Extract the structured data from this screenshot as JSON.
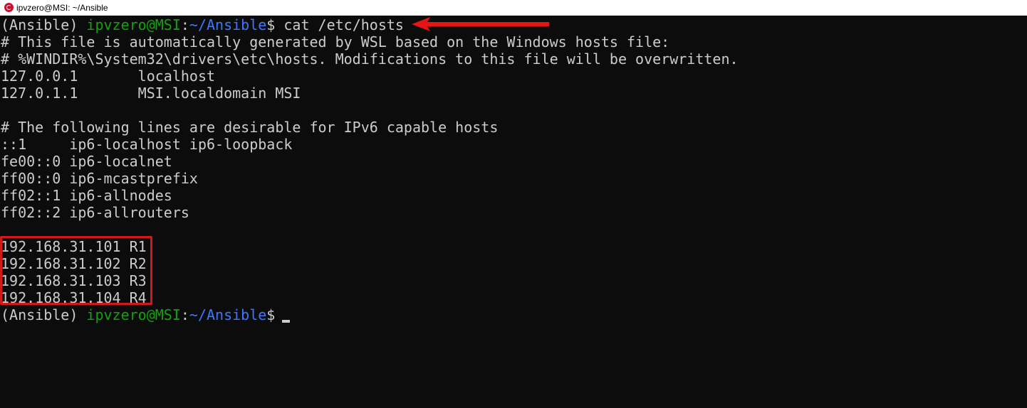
{
  "window": {
    "title": "ipvzero@MSI: ~/Ansible",
    "icon": "debian-swirl-icon",
    "accent_color": "#c8102e"
  },
  "prompt": {
    "env": "(Ansible)",
    "user_host": "ipvzero@MSI",
    "colon": ":",
    "path": "~/Ansible",
    "symbol": "$",
    "user_color": "#13a10e",
    "path_color": "#3b78ff"
  },
  "command": "cat /etc/hosts",
  "output": [
    "# This file is automatically generated by WSL based on the Windows hosts file:",
    "# %WINDIR%\\System32\\drivers\\etc\\hosts. Modifications to this file will be overwritten.",
    "127.0.0.1       localhost",
    "127.0.1.1       MSI.localdomain MSI",
    "",
    "# The following lines are desirable for IPv6 capable hosts",
    "::1     ip6-localhost ip6-loopback",
    "fe00::0 ip6-localnet",
    "ff00::0 ip6-mcastprefix",
    "ff02::1 ip6-allnodes",
    "ff02::2 ip6-allrouters",
    "",
    "192.168.31.101 R1",
    "192.168.31.102 R2",
    "192.168.31.103 R3",
    "192.168.31.104 R4"
  ],
  "annotations": {
    "arrow_color": "#e81414",
    "box_color": "#d11919",
    "arrow_icon": "red-arrow-icon",
    "highlight": "red-highlight-box"
  }
}
